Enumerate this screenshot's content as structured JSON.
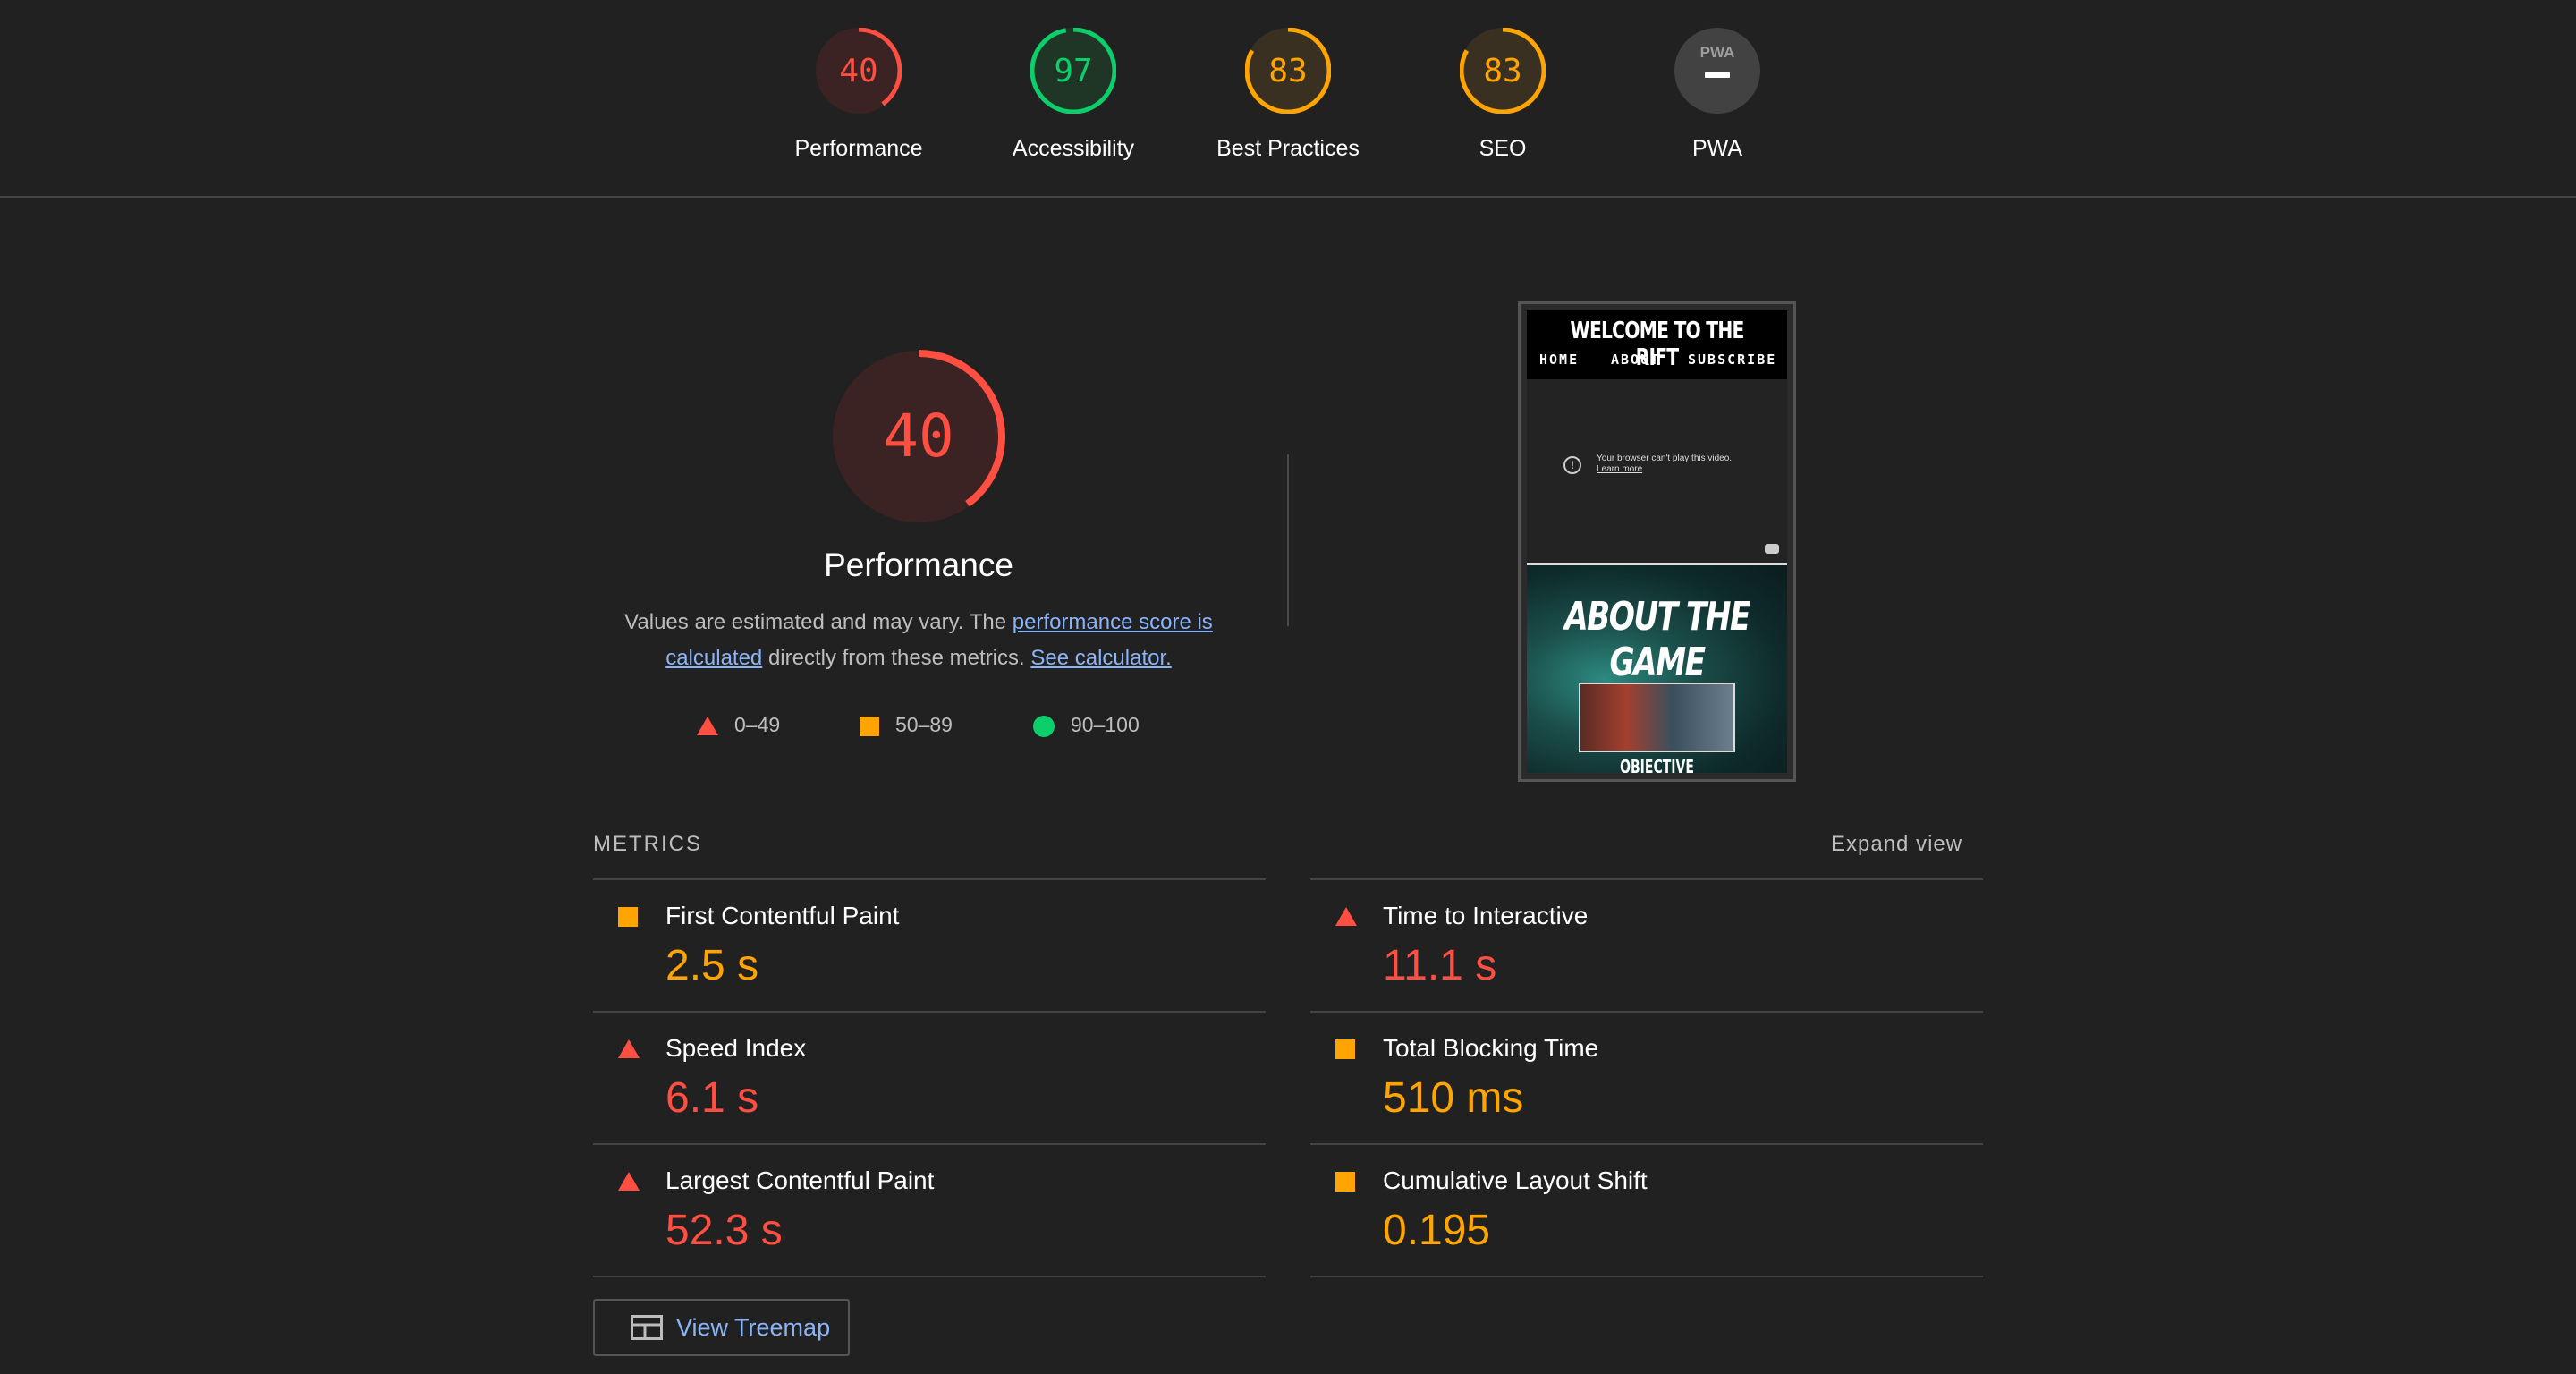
{
  "categories": [
    {
      "label": "Performance",
      "score": "40",
      "color": "#ff4e42",
      "bg": "#3a2322",
      "fraction": 0.4
    },
    {
      "label": "Accessibility",
      "score": "97",
      "color": "#0cce6b",
      "bg": "#1f3526",
      "fraction": 0.97
    },
    {
      "label": "Best Practices",
      "score": "83",
      "color": "#ffa400",
      "bg": "#3a3022",
      "fraction": 0.83
    },
    {
      "label": "SEO",
      "score": "83",
      "color": "#ffa400",
      "bg": "#3a3022",
      "fraction": 0.83
    },
    {
      "label": "PWA",
      "score": "",
      "badge": "PWA",
      "color": "#bdbdbd",
      "bg": "#424242",
      "fraction": 0
    }
  ],
  "hero": {
    "score": "40",
    "title": "Performance",
    "desc_prefix": "Values are estimated and may vary. The ",
    "link_score": "performance score is calculated",
    "desc_mid": " directly from these metrics. ",
    "link_calc": "See calculator."
  },
  "legend": {
    "fail": "0–49",
    "average": "50–89",
    "pass": "90–100"
  },
  "screenshot": {
    "site_title": "WELCOME TO THE RIFT",
    "nav": [
      "HOME",
      "ABOUT",
      "SUBSCRIBE"
    ],
    "video_msg": "Your browser can't play this video.",
    "video_link": "Learn more",
    "about_title": "ABOUT THE GAME",
    "objective": "OBJECTIVE"
  },
  "metrics": {
    "header": "METRICS",
    "expand": "Expand view",
    "items": [
      {
        "name": "First Contentful Paint",
        "value": "2.5 s",
        "rating": "average"
      },
      {
        "name": "Time to Interactive",
        "value": "11.1 s",
        "rating": "fail"
      },
      {
        "name": "Speed Index",
        "value": "6.1 s",
        "rating": "fail"
      },
      {
        "name": "Total Blocking Time",
        "value": "510 ms",
        "rating": "average"
      },
      {
        "name": "Largest Contentful Paint",
        "value": "52.3 s",
        "rating": "fail"
      },
      {
        "name": "Cumulative Layout Shift",
        "value": "0.195",
        "rating": "average"
      }
    ]
  },
  "treemap": {
    "label": "View Treemap"
  }
}
